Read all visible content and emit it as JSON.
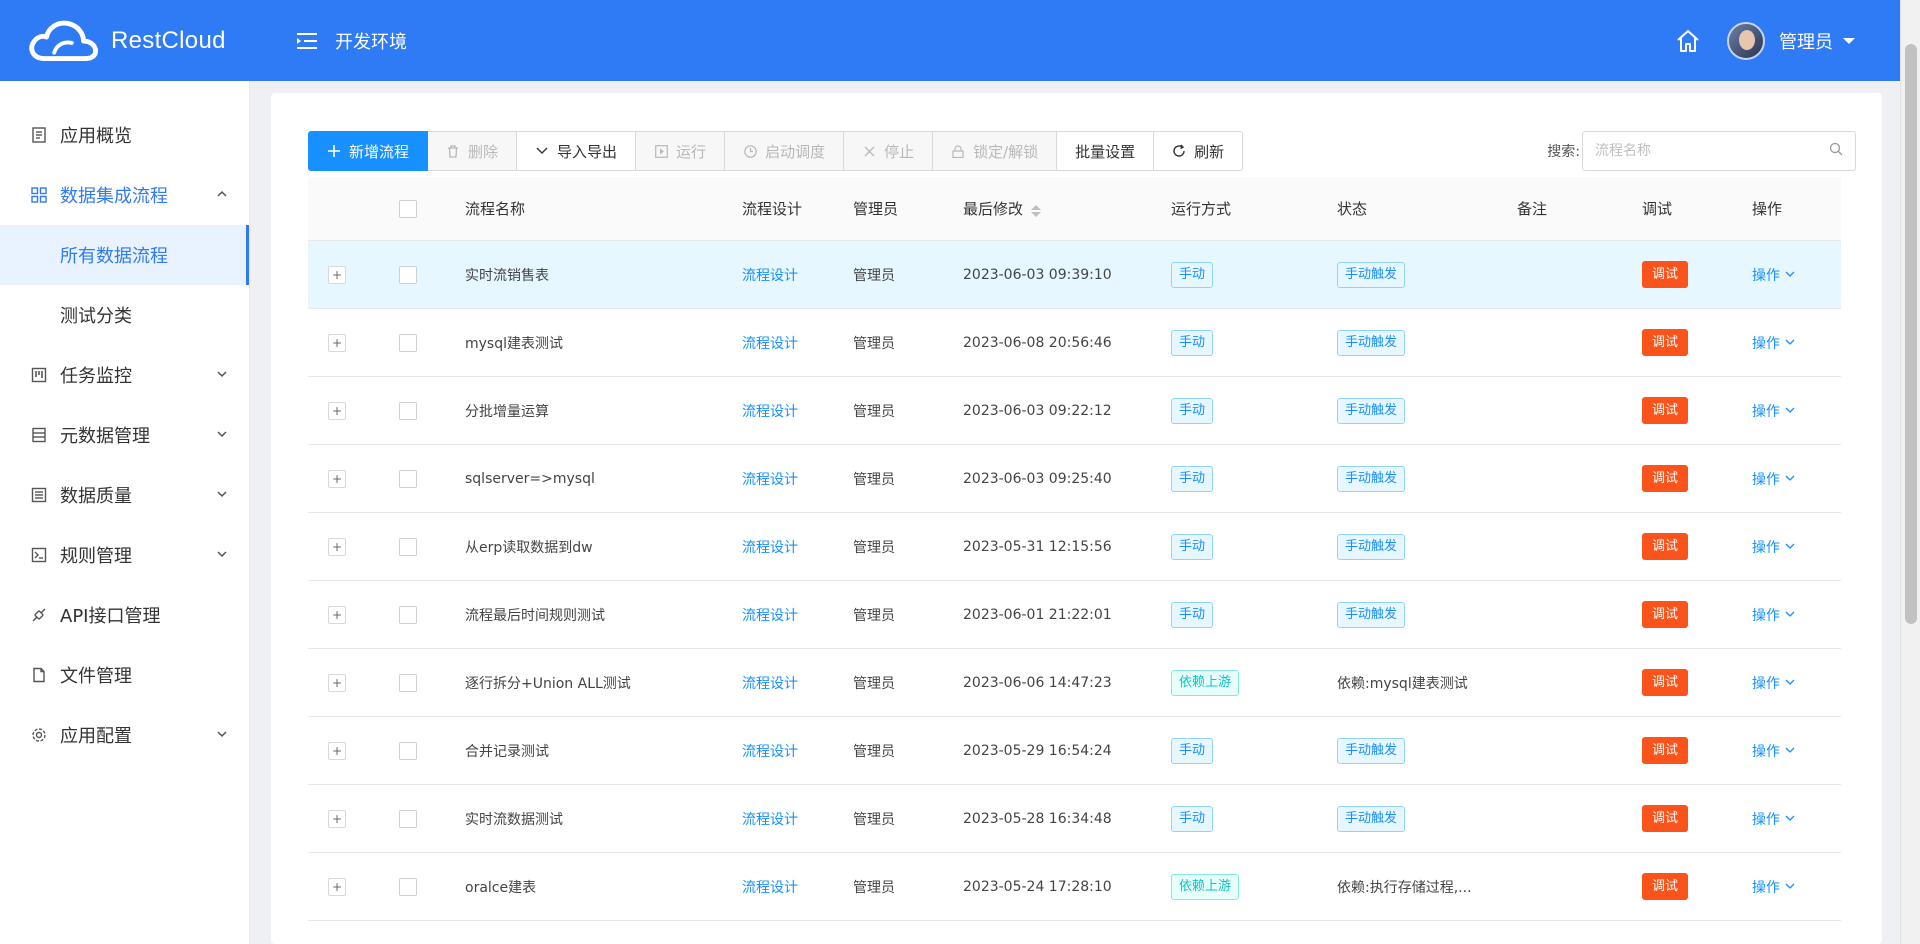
{
  "header": {
    "logo_text": "RestCloud",
    "env_label": "开发环境",
    "user_name": "管理员"
  },
  "sidebar": {
    "items": [
      {
        "label": "应用概览",
        "icon": "document-icon",
        "has_children": false
      },
      {
        "label": "数据集成流程",
        "icon": "grid-icon",
        "has_children": true,
        "open": true,
        "children": [
          {
            "label": "所有数据流程",
            "active": true
          },
          {
            "label": "测试分类",
            "active": false
          }
        ]
      },
      {
        "label": "任务监控",
        "icon": "monitor-icon",
        "has_children": true
      },
      {
        "label": "元数据管理",
        "icon": "database-icon",
        "has_children": true
      },
      {
        "label": "数据质量",
        "icon": "quality-icon",
        "has_children": true
      },
      {
        "label": "规则管理",
        "icon": "terminal-icon",
        "has_children": true
      },
      {
        "label": "API接口管理",
        "icon": "api-icon",
        "has_children": false
      },
      {
        "label": "文件管理",
        "icon": "file-icon",
        "has_children": false
      },
      {
        "label": "应用配置",
        "icon": "settings-icon",
        "has_children": true
      }
    ]
  },
  "toolbar": {
    "add": "新增流程",
    "delete": "删除",
    "import_export": "导入导出",
    "run": "运行",
    "schedule": "启动调度",
    "stop": "停止",
    "lock": "锁定/解锁",
    "batch": "批量设置",
    "refresh": "刷新"
  },
  "search": {
    "label": "搜索:",
    "placeholder": "流程名称"
  },
  "table": {
    "columns": {
      "name": "流程名称",
      "design": "流程设计",
      "admin": "管理员",
      "modified": "最后修改",
      "run_mode": "运行方式",
      "status": "状态",
      "remark": "备注",
      "debug": "调试",
      "op": "操作"
    },
    "rows": [
      {
        "name": "实时流销售表",
        "design": "流程设计",
        "admin": "管理员",
        "modified": "2023-06-03 09:39:10",
        "run_mode": "手动",
        "run_type": "manual",
        "status": "手动触发",
        "status_type": "tag",
        "debug": "调试",
        "op": "操作",
        "highlight": true
      },
      {
        "name": "mysql建表测试",
        "design": "流程设计",
        "admin": "管理员",
        "modified": "2023-06-08 20:56:46",
        "run_mode": "手动",
        "run_type": "manual",
        "status": "手动触发",
        "status_type": "tag",
        "debug": "调试",
        "op": "操作"
      },
      {
        "name": "分批增量运算",
        "design": "流程设计",
        "admin": "管理员",
        "modified": "2023-06-03 09:22:12",
        "run_mode": "手动",
        "run_type": "manual",
        "status": "手动触发",
        "status_type": "tag",
        "debug": "调试",
        "op": "操作"
      },
      {
        "name": "sqlserver=>mysql",
        "design": "流程设计",
        "admin": "管理员",
        "modified": "2023-06-03 09:25:40",
        "run_mode": "手动",
        "run_type": "manual",
        "status": "手动触发",
        "status_type": "tag",
        "debug": "调试",
        "op": "操作"
      },
      {
        "name": "从erp读取数据到dw",
        "design": "流程设计",
        "admin": "管理员",
        "modified": "2023-05-31 12:15:56",
        "run_mode": "手动",
        "run_type": "manual",
        "status": "手动触发",
        "status_type": "tag",
        "debug": "调试",
        "op": "操作"
      },
      {
        "name": "流程最后时间规则测试",
        "design": "流程设计",
        "admin": "管理员",
        "modified": "2023-06-01 21:22:01",
        "run_mode": "手动",
        "run_type": "manual",
        "status": "手动触发",
        "status_type": "tag",
        "debug": "调试",
        "op": "操作"
      },
      {
        "name": "逐行拆分+Union ALL测试",
        "design": "流程设计",
        "admin": "管理员",
        "modified": "2023-06-06 14:47:23",
        "run_mode": "依赖上游",
        "run_type": "upstream",
        "status": "依赖:mysql建表测试",
        "status_type": "text",
        "debug": "调试",
        "op": "操作"
      },
      {
        "name": "合并记录测试",
        "design": "流程设计",
        "admin": "管理员",
        "modified": "2023-05-29 16:54:24",
        "run_mode": "手动",
        "run_type": "manual",
        "status": "手动触发",
        "status_type": "tag",
        "debug": "调试",
        "op": "操作"
      },
      {
        "name": "实时流数据测试",
        "design": "流程设计",
        "admin": "管理员",
        "modified": "2023-05-28 16:34:48",
        "run_mode": "手动",
        "run_type": "manual",
        "status": "手动触发",
        "status_type": "tag",
        "debug": "调试",
        "op": "操作"
      },
      {
        "name": "oralce建表",
        "design": "流程设计",
        "admin": "管理员",
        "modified": "2023-05-24 17:28:10",
        "run_mode": "依赖上游",
        "run_type": "upstream",
        "status": "依赖:执行存储过程,...",
        "status_type": "text",
        "debug": "调试",
        "op": "操作"
      }
    ]
  },
  "colors": {
    "header_bg": "#2f7af5",
    "primary": "#1890ff",
    "debug_btn": "#fa541c",
    "row_highlight": "#e6f7ff"
  }
}
